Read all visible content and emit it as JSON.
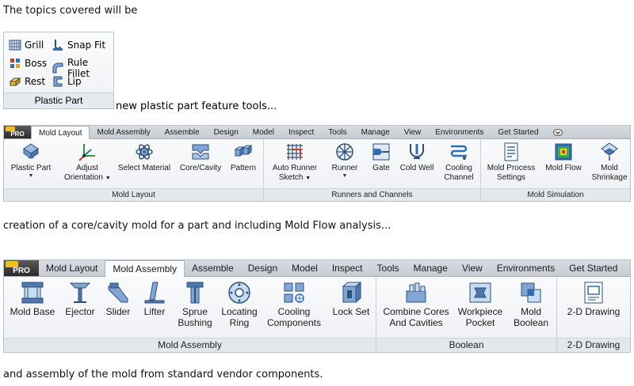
{
  "intro_text": "The topics covered will be",
  "plastic_part_panel": {
    "items": [
      "Grill",
      "Snap Fit",
      "Boss",
      "Rule Fillet",
      "Rest",
      "Lip"
    ],
    "label": "Plastic Part"
  },
  "tools_caption": "new plastic part feature tools...",
  "ribbon1": {
    "pro": "PRO",
    "tabs": [
      "Mold Layout",
      "Mold Assembly",
      "Assemble",
      "Design",
      "Model",
      "Inspect",
      "Tools",
      "Manage",
      "View",
      "Environments",
      "Get Started"
    ],
    "tools": [
      {
        "l1": "Plastic Part",
        "l2": ""
      },
      {
        "l1": "Adjust",
        "l2": "Orientation"
      },
      {
        "l1": "Select Material",
        "l2": ""
      },
      {
        "l1": "Core/Cavity",
        "l2": ""
      },
      {
        "l1": "Pattern",
        "l2": ""
      },
      {
        "l1": "Auto Runner",
        "l2": "Sketch"
      },
      {
        "l1": "Runner",
        "l2": ""
      },
      {
        "l1": "Gate",
        "l2": ""
      },
      {
        "l1": "Cold Well",
        "l2": ""
      },
      {
        "l1": "Cooling",
        "l2": "Channel"
      },
      {
        "l1": "Mold Process",
        "l2": "Settings"
      },
      {
        "l1": "Mold Flow",
        "l2": ""
      },
      {
        "l1": "Mold",
        "l2": "Shrinkage"
      }
    ],
    "groups": [
      "Mold Layout",
      "Runners and Channels",
      "Mold Simulation"
    ]
  },
  "caption2": "creation of a core/cavity mold for a part and including Mold Flow analysis...",
  "ribbon2": {
    "pro": "PRO",
    "tabs": [
      "Mold Layout",
      "Mold Assembly",
      "Assemble",
      "Design",
      "Model",
      "Inspect",
      "Tools",
      "Manage",
      "View",
      "Environments",
      "Get Started"
    ],
    "tools": [
      {
        "l1": "Mold Base",
        "l2": ""
      },
      {
        "l1": "Ejector",
        "l2": ""
      },
      {
        "l1": "Slider",
        "l2": ""
      },
      {
        "l1": "Lifter",
        "l2": ""
      },
      {
        "l1": "Sprue",
        "l2": "Bushing"
      },
      {
        "l1": "Locating",
        "l2": "Ring"
      },
      {
        "l1": "Cooling",
        "l2": "Components"
      },
      {
        "l1": "Lock Set",
        "l2": ""
      },
      {
        "l1": "Combine Cores",
        "l2": "And Cavities"
      },
      {
        "l1": "Workpiece",
        "l2": "Pocket"
      },
      {
        "l1": "Mold",
        "l2": "Boolean"
      },
      {
        "l1": "2-D Drawing",
        "l2": ""
      }
    ],
    "groups": [
      "Mold Assembly",
      "Boolean",
      "2-D Drawing"
    ]
  },
  "caption3": "and assembly of the mold from standard vendor components.",
  "colors": {
    "accent_blue": "#2f6db5",
    "ribbon_tab_bg": "#c7ccd2",
    "active_tab_bg": "#fbfcfd"
  }
}
